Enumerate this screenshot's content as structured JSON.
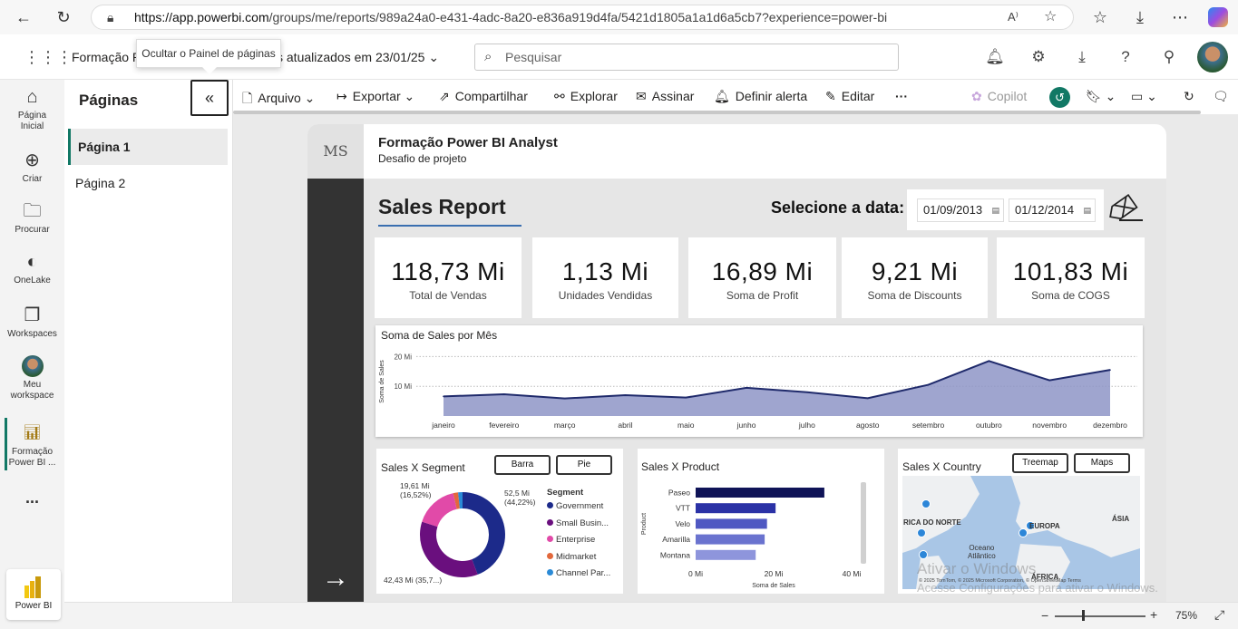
{
  "browser": {
    "url_host": "https://app.powerbi.com",
    "url_path": "/groups/me/reports/989a24a0-e431-4adc-8a20-e836a919d4fa/5421d1805a1a1d6a5cb7?experience=power-bi"
  },
  "header": {
    "report_name": "Formação P",
    "updated": "s atualizados em 23/01/25",
    "search_placeholder": "Pesquisar",
    "tooltip": "Ocultar o Painel de páginas"
  },
  "leftnav": {
    "items": [
      {
        "label": "Página\nInicial",
        "icon": "home-icon"
      },
      {
        "label": "Criar",
        "icon": "plus-circle-icon"
      },
      {
        "label": "Procurar",
        "icon": "folder-icon"
      },
      {
        "label": "OneLake",
        "icon": "onelake-icon"
      },
      {
        "label": "Workspaces",
        "icon": "workspaces-icon"
      },
      {
        "label": "Meu\nworkspace",
        "icon": "avatar"
      },
      {
        "label": "Formação\nPower BI ...",
        "icon": "report-icon"
      },
      {
        "label": "...",
        "icon": "more-icon"
      }
    ],
    "powerbi": "Power BI"
  },
  "pages_panel": {
    "title": "Páginas",
    "collapse": "«",
    "pages": [
      "Página 1",
      "Página 2"
    ]
  },
  "toolbar": {
    "arquivo": "Arquivo",
    "exportar": "Exportar",
    "compartilhar": "Compartilhar",
    "explorar": "Explorar",
    "assinar": "Assinar",
    "alerta": "Definir alerta",
    "editar": "Editar",
    "more": "···",
    "copilot": "Copilot"
  },
  "report": {
    "logo": "MS",
    "title": "Formação Power BI Analyst",
    "subtitle": "Desafio de projeto",
    "heading": "Sales Report",
    "date_label": "Selecione a data:",
    "date_from": "01/09/2013",
    "date_to": "01/12/2014",
    "cards": [
      {
        "value": "118,73 Mi",
        "label": "Total de Vendas"
      },
      {
        "value": "1,13 Mi",
        "label": "Unidades Vendidas"
      },
      {
        "value": "16,89 Mi",
        "label": "Soma de Profit"
      },
      {
        "value": "9,21 Mi",
        "label": "Soma de Discounts"
      },
      {
        "value": "101,83 Mi",
        "label": "Soma de COGS"
      }
    ],
    "segment_title": "Sales X Segment",
    "segment_btn1": "Barra",
    "segment_btn2": "Pie",
    "segment_legend_title": "Segment",
    "segment_labels": {
      "tl_value": "19,61 Mi",
      "tl_pct": "(16,52%)",
      "tr_value": "52,5 Mi",
      "tr_pct": "(44,22%)",
      "bl": "42,43 Mi (35,7...)"
    },
    "product_title": "Sales X Product",
    "country_title": "Sales X Country",
    "country_btn1": "Treemap",
    "country_btn2": "Maps",
    "map_labels": {
      "na": "RICA DO NORTE",
      "eu": "EUROPA",
      "asia": "ÁSIA",
      "ocean1": "Oceano",
      "ocean2": "Atlântico",
      "africa": "ÁFRICA",
      "credit": "© 2025 TomTom, © 2025 Microsoft Corporation, © OpenStreetMap  Terms"
    }
  },
  "chart_data": [
    {
      "type": "area",
      "title": "Soma de Sales por Mês",
      "ylabel": "Soma de Sales",
      "categories": [
        "janeiro",
        "fevereiro",
        "março",
        "abril",
        "maio",
        "junho",
        "julho",
        "agosto",
        "setembro",
        "outubro",
        "novembro",
        "dezembro"
      ],
      "values": [
        6.6,
        7.3,
        5.9,
        7.0,
        6.2,
        9.5,
        8.0,
        6.0,
        10.5,
        18.5,
        12.0,
        15.5
      ],
      "yticks": [
        "10 Mi",
        "20 Mi"
      ],
      "ylim": [
        0,
        25
      ],
      "color": "#1f2a6b",
      "fill": "#8e95c7"
    },
    {
      "type": "pie",
      "title": "Sales X Segment",
      "series": [
        {
          "name": "Government",
          "value": 52.5,
          "color": "#1c2a8a"
        },
        {
          "name": "Small Busin...",
          "value": 42.43,
          "color": "#6a0f7e"
        },
        {
          "name": "Enterprise",
          "value": 19.61,
          "color": "#e14aa8"
        },
        {
          "name": "Midmarket",
          "value": 2.2,
          "color": "#e2683c"
        },
        {
          "name": "Channel Par...",
          "value": 1.99,
          "color": "#2a8ad6"
        }
      ]
    },
    {
      "type": "bar",
      "title": "Sales X Product",
      "xlabel": "Soma de Sales",
      "ylabel": "Product",
      "categories": [
        "Paseo",
        "VTT",
        "Velo",
        "Amarilla",
        "Montana"
      ],
      "values": [
        33.0,
        20.5,
        18.3,
        17.7,
        15.4
      ],
      "xticks": [
        "0 Mi",
        "20 Mi",
        "40 Mi"
      ],
      "xlim": [
        0,
        40
      ],
      "colors": [
        "#0f1357",
        "#2b32a6",
        "#4f58c2",
        "#6a73cf",
        "#8e95dc"
      ]
    }
  ],
  "status": {
    "zoom": "75%"
  },
  "watermark": {
    "line1": "Ativar o Windows",
    "line2": "Acesse Configurações para ativar o Windows."
  }
}
